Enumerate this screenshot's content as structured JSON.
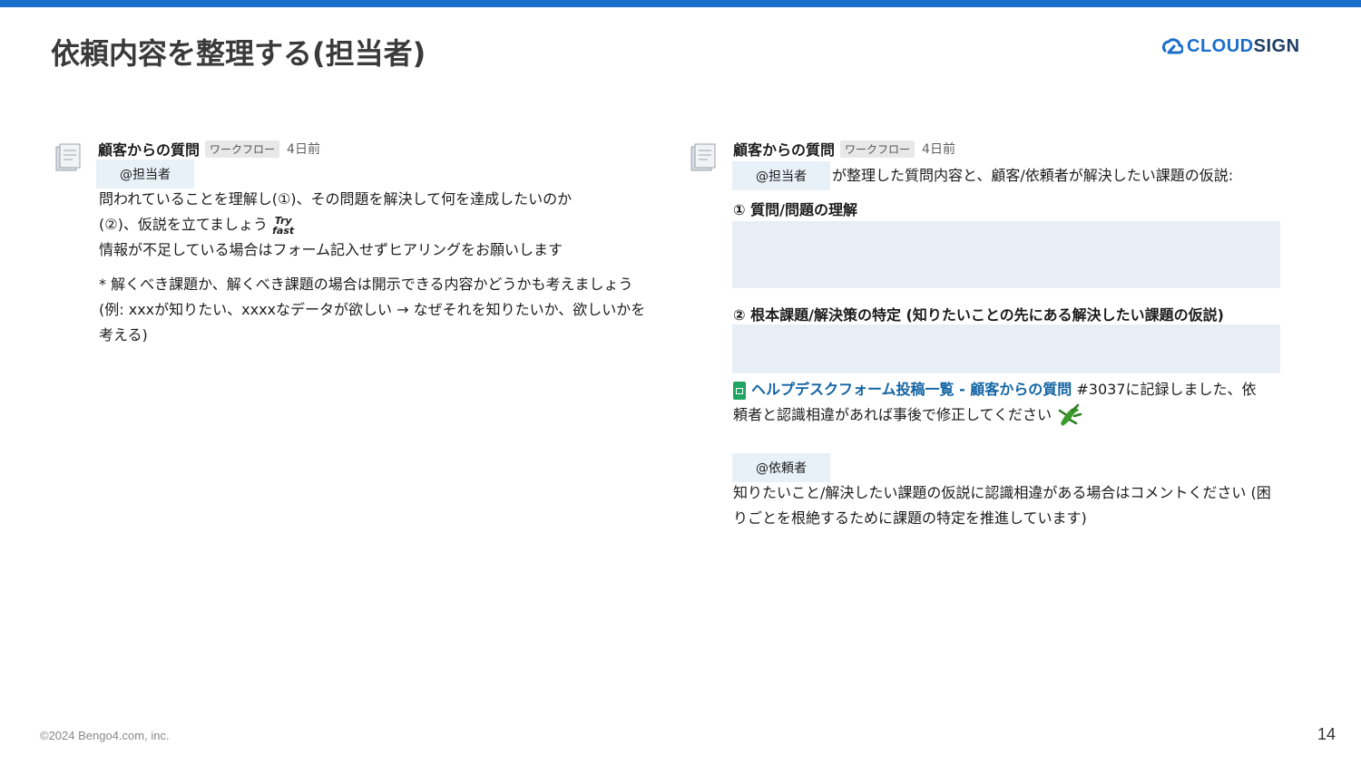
{
  "slide": {
    "title": "依頼内容を整理する(担当者)",
    "logo_part1": "CLOUD",
    "logo_part2": "SIGN",
    "footer": "©2024 Bengo4.com, inc.",
    "page_number": "14"
  },
  "left_message": {
    "sender": "顧客からの質問",
    "badge": "ワークフロー",
    "time": "4日前",
    "mention": "@担当者",
    "line1": "問われていることを理解し(①)、その問題を解決して何を達成したいのか",
    "line2": "(②)、仮説を立てましょう",
    "emoji_top": "Try",
    "emoji_bottom": "fast",
    "line3": "情報が不足している場合はフォーム記入せずヒアリングをお願いします",
    "note": "* 解くべき課題か、解くべき課題の場合は開示できる内容かどうかも考えましょう(例: xxxが知りたい、xxxxなデータが欲しい → なぜそれを知りたいか、欲しいかを考える)"
  },
  "right_message": {
    "sender": "顧客からの質問",
    "badge": "ワークフロー",
    "time": "4日前",
    "mention": "@担当者",
    "mention_suffix": "が整理した質問内容と、顧客/依頼者が解決したい課題の仮説:",
    "heading1": "① 質問/問題の理解",
    "heading2": "② 根本課題/解決策の特定 (知りたいことの先にある解決したい課題の仮説)",
    "link_text": "ヘルプデスクフォーム投稿一覧 - 顧客からの質問",
    "link_suffix": " #3037に記録しました、依頼者と認識相違があれば事後で修正してください",
    "mention2": "@依頼者",
    "closing": "知りたいこと/解決したい課題の仮説に認識相違がある場合はコメントください (困りごとを根絶するために課題の特定を推進しています)"
  },
  "colors": {
    "accent": "#1a6fcb",
    "mention_bg": "#e8f0f8",
    "box_bg": "#e8eef5",
    "link": "#1264a3"
  }
}
